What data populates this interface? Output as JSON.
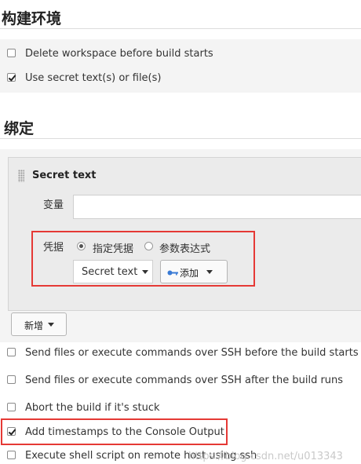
{
  "build_env": {
    "title": "构建环境",
    "options": [
      {
        "label": "Delete workspace before build starts",
        "checked": false
      },
      {
        "label": "Use secret text(s) or file(s)",
        "checked": true
      }
    ]
  },
  "bindings": {
    "title": "绑定",
    "secret_text": {
      "title": "Secret text",
      "variable_label": "变量",
      "variable_value": "",
      "credentials_label": "凭据",
      "radio_specific": "指定凭据",
      "radio_expression": "参数表达式",
      "selected_credential": "Secret text",
      "add_button": "添加"
    },
    "new_button": "新增"
  },
  "more_options": [
    {
      "label": "Send files or execute commands over SSH before the build starts",
      "checked": false
    },
    {
      "label": "Send files or execute commands over SSH after the build runs",
      "checked": false
    },
    {
      "label": "Abort the build if it's stuck",
      "checked": false
    },
    {
      "label": "Add timestamps to the Console Output",
      "checked": true
    },
    {
      "label": "Execute shell script on remote host using ssh",
      "checked": false
    }
  ],
  "watermark": "https://blog.csdn.net/u013343",
  "colors": {
    "highlight": "#e53935",
    "key_icon": "#3a7bd5"
  }
}
